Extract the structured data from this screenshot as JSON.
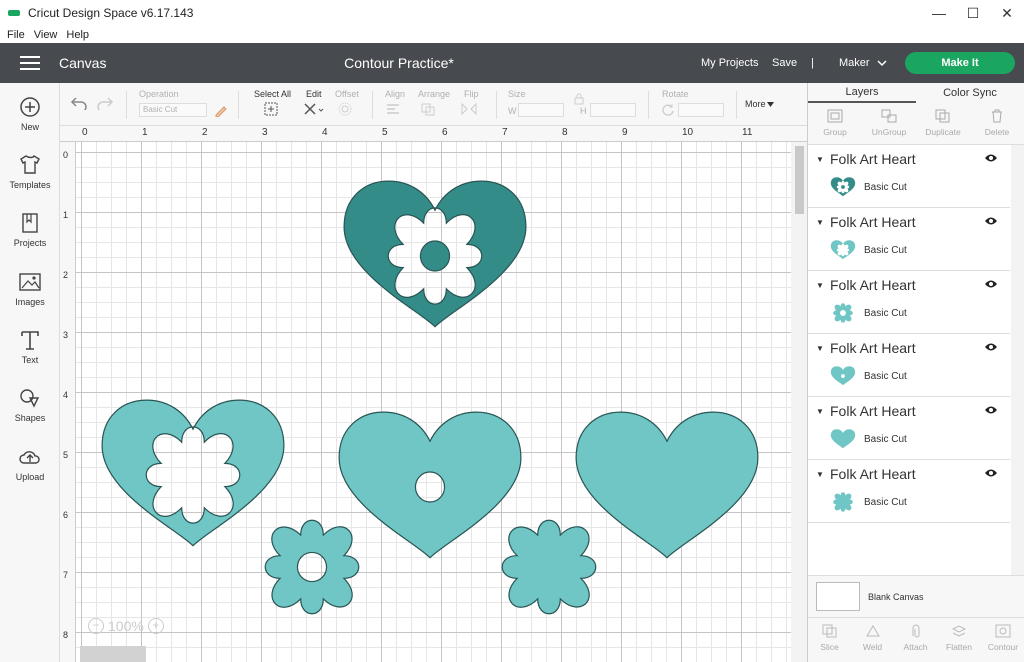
{
  "window": {
    "title": "Cricut Design Space  v6.17.143",
    "minimize": "—",
    "maximize": "☐",
    "close": "✕"
  },
  "menu": [
    "File",
    "View",
    "Help"
  ],
  "header": {
    "canvas_label": "Canvas",
    "project_title": "Contour Practice*",
    "my_projects": "My Projects",
    "save": "Save",
    "divider": "|",
    "machine": "Maker",
    "make_it": "Make It"
  },
  "left_tools": [
    {
      "label": "New",
      "icon": "plus-circle-icon"
    },
    {
      "label": "Templates",
      "icon": "tshirt-icon"
    },
    {
      "label": "Projects",
      "icon": "book-icon"
    },
    {
      "label": "Images",
      "icon": "image-icon"
    },
    {
      "label": "Text",
      "icon": "text-icon"
    },
    {
      "label": "Shapes",
      "icon": "shapes-icon"
    },
    {
      "label": "Upload",
      "icon": "upload-cloud-icon"
    }
  ],
  "edit_bar": {
    "operation_label": "Operation",
    "operation_value": "Basic Cut",
    "select_all": "Select All",
    "edit": "Edit",
    "offset": "Offset",
    "align": "Align",
    "arrange": "Arrange",
    "flip": "Flip",
    "size": "Size",
    "w": "W",
    "h": "H",
    "rotate": "Rotate",
    "more": "More"
  },
  "ruler": {
    "top": [
      "0",
      "1",
      "2",
      "3",
      "4",
      "5",
      "6",
      "7",
      "8",
      "9",
      "10",
      "11"
    ],
    "left": [
      "0",
      "1",
      "2",
      "3",
      "4",
      "5",
      "6",
      "7",
      "8"
    ]
  },
  "zoom": {
    "level": "100%",
    "minus": "−",
    "plus": "+"
  },
  "right_panel": {
    "tabs": [
      "Layers",
      "Color Sync"
    ],
    "tools": [
      "Group",
      "UnGroup",
      "Duplicate",
      "Delete"
    ],
    "layers": [
      {
        "name": "Folk Art Heart",
        "operation": "Basic Cut",
        "thumb": "heart-dark"
      },
      {
        "name": "Folk Art Heart",
        "operation": "Basic Cut",
        "thumb": "heart-cutout"
      },
      {
        "name": "Folk Art Heart",
        "operation": "Basic Cut",
        "thumb": "flower"
      },
      {
        "name": "Folk Art Heart",
        "operation": "Basic Cut",
        "thumb": "heart-dot"
      },
      {
        "name": "Folk Art Heart",
        "operation": "Basic Cut",
        "thumb": "heart"
      },
      {
        "name": "Folk Art Heart",
        "operation": "Basic Cut",
        "thumb": "flower-solid"
      }
    ],
    "blank_canvas": "Blank Canvas",
    "bottom_tools": [
      "Slice",
      "Weld",
      "Attach",
      "Flatten",
      "Contour"
    ]
  },
  "colors": {
    "teal_dark": "#348c88",
    "teal_light": "#6fc6c4",
    "make_it": "#1aa661",
    "header": "#474a4e"
  }
}
